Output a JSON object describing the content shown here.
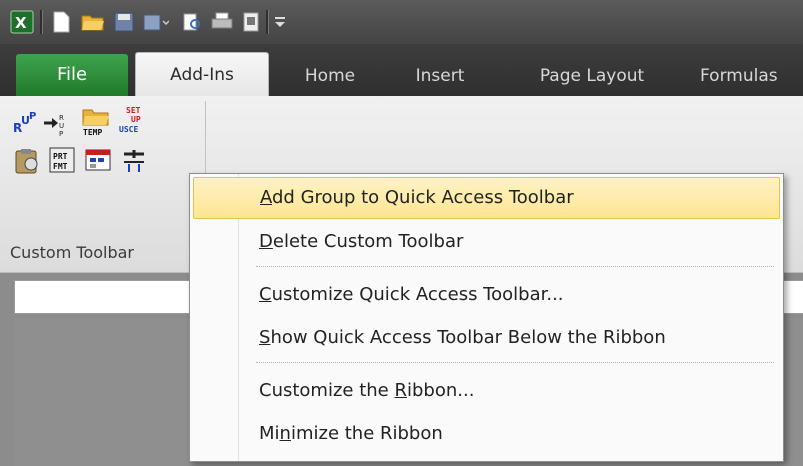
{
  "tabs": {
    "file": "File",
    "addins": "Add-Ins",
    "home": "Home",
    "insert": "Insert",
    "page_layout": "Page Layout",
    "formulas": "Formulas"
  },
  "ribbon": {
    "group_label": "Custom Toolbar",
    "buttons": {
      "temp": "TEMP",
      "setup_top": "SET",
      "setup_mid": "UP",
      "setup_bottom": "USCE",
      "prt_top": "PRT",
      "prt_bottom": "FMT",
      "arrow_r": "R",
      "arrow_u": "U",
      "arrow_p": "P"
    }
  },
  "menu": {
    "items": [
      {
        "pre": "",
        "acc": "A",
        "post": "dd Group to Quick Access Toolbar"
      },
      {
        "pre": "",
        "acc": "D",
        "post": "elete Custom Toolbar"
      },
      {
        "pre": "",
        "acc": "C",
        "post": "ustomize Quick Access Toolbar..."
      },
      {
        "pre": "",
        "acc": "S",
        "post": "how Quick Access Toolbar Below the Ribbon"
      },
      {
        "pre": "Customize the ",
        "acc": "R",
        "post": "ibbon..."
      },
      {
        "pre": "Mi",
        "acc": "n",
        "post": "imize the Ribbon"
      }
    ]
  },
  "colors": {
    "file_tab": "#2a8c37",
    "highlight": "#fde591"
  },
  "icons": [
    "excel-logo-icon",
    "new-document-icon",
    "open-folder-icon",
    "save-icon",
    "print-preview-icon",
    "customize-qat-icon"
  ]
}
